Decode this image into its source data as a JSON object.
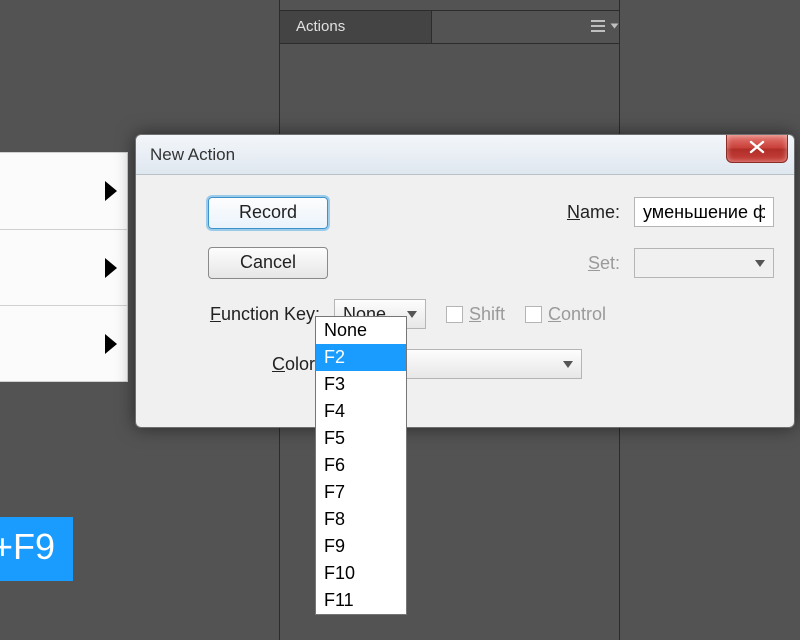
{
  "app": {
    "actions_panel_title": "Actions"
  },
  "left_badge_text": "+F9",
  "dialog": {
    "title": "New Action",
    "labels": {
      "name_pre": "N",
      "name_post": "ame:",
      "set_pre": "S",
      "set_post": "et:",
      "fn_pre": "F",
      "fn_post": "unction Key:",
      "color_pre": "C",
      "color_post": "olor:"
    },
    "name_value": "уменьшение фотографий",
    "set_value": "",
    "fn_selected": "None",
    "shift_pre": "S",
    "shift_post": "hift",
    "control_pre": "C",
    "control_post": "ontrol",
    "color_value": "",
    "buttons": {
      "record": "Record",
      "cancel": "Cancel"
    },
    "fn_options": [
      "None",
      "F2",
      "F3",
      "F4",
      "F5",
      "F6",
      "F7",
      "F8",
      "F9",
      "F10",
      "F11"
    ],
    "fn_highlight_index": 1
  }
}
